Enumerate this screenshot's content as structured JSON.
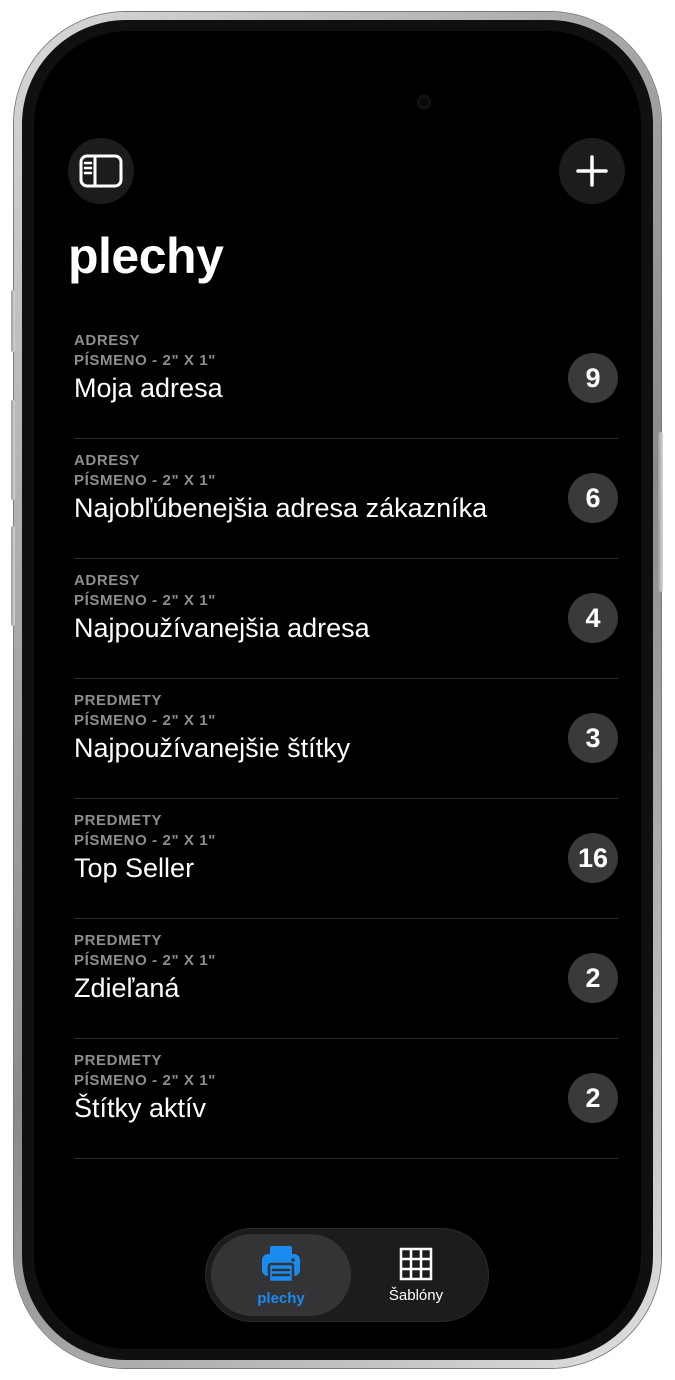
{
  "header": {
    "title": "plechy",
    "sidebar_icon": "sidebar-icon",
    "add_icon": "plus-icon"
  },
  "list": {
    "items": [
      {
        "category": "ADRESY",
        "size": "PÍSMENO - 2\" X 1\"",
        "name": "Moja adresa",
        "count": "9"
      },
      {
        "category": "ADRESY",
        "size": "PÍSMENO - 2\" X 1\"",
        "name": "Najobľúbenejšia adresa zákazníka",
        "count": "6"
      },
      {
        "category": "ADRESY",
        "size": "PÍSMENO - 2\" X 1\"",
        "name": "Najpoužívanejšia adresa",
        "count": "4"
      },
      {
        "category": "PREDMETY",
        "size": "PÍSMENO - 2\" X 1\"",
        "name": "Najpoužívanejšie štítky",
        "count": "3"
      },
      {
        "category": "PREDMETY",
        "size": "PÍSMENO - 2\" X 1\"",
        "name": "Top Seller",
        "count": "16"
      },
      {
        "category": "PREDMETY",
        "size": "PÍSMENO - 2\" X 1\"",
        "name": "Zdieľaná",
        "count": "2"
      },
      {
        "category": "PREDMETY",
        "size": "PÍSMENO - 2\" X 1\"",
        "name": "Štítky aktív",
        "count": "2"
      }
    ]
  },
  "tabbar": {
    "tabs": [
      {
        "label": "plechy",
        "icon": "printer-icon",
        "active": true
      },
      {
        "label": "Šablóny",
        "icon": "grid-icon",
        "active": false
      }
    ]
  },
  "colors": {
    "accent": "#1a8bf0",
    "background": "#000000",
    "badge": "#3a3a3c",
    "secondary_text": "#8d8d92"
  }
}
